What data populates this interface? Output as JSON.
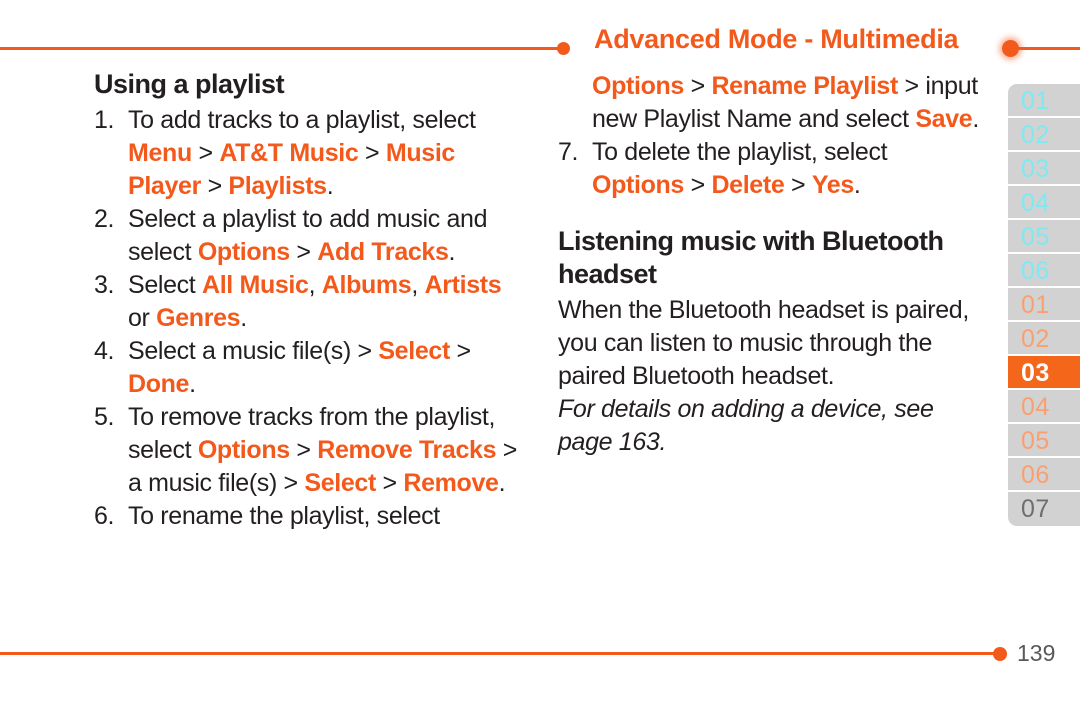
{
  "header": {
    "title": "Advanced Mode - Multimedia",
    "left_dot": "bullet-dot",
    "right_dot": "bullet-dot"
  },
  "colors": {
    "accent_orange": "#f4591c",
    "active_tab_orange": "#f4661a",
    "tab_background_gray": "#d2d2d2",
    "tab_cyan_text": "#7fe9f2",
    "tab_orange_text": "#f9a072",
    "body_text": "#231f20",
    "page_number_gray": "#58595b"
  },
  "left_column": {
    "heading": "Using a playlist",
    "steps": [
      {
        "num": "1.",
        "parts": [
          {
            "t": "To add tracks to a playlist, select ",
            "s": "plain"
          },
          {
            "t": "Menu",
            "s": "hl"
          },
          {
            "t": " > ",
            "s": "sep"
          },
          {
            "t": "AT&T Music",
            "s": "hl"
          },
          {
            "t": " > ",
            "s": "sep"
          },
          {
            "t": "Music Player",
            "s": "hl"
          },
          {
            "t": " > ",
            "s": "sep"
          },
          {
            "t": "Playlists",
            "s": "hl"
          },
          {
            "t": ".",
            "s": "plain"
          }
        ]
      },
      {
        "num": "2.",
        "parts": [
          {
            "t": "Select a playlist to add music and select ",
            "s": "plain"
          },
          {
            "t": "Options",
            "s": "hl"
          },
          {
            "t": " > ",
            "s": "sep"
          },
          {
            "t": "Add Tracks",
            "s": "hl"
          },
          {
            "t": ".",
            "s": "plain"
          }
        ]
      },
      {
        "num": "3.",
        "parts": [
          {
            "t": "Select ",
            "s": "plain"
          },
          {
            "t": "All Music",
            "s": "hl"
          },
          {
            "t": ", ",
            "s": "plain"
          },
          {
            "t": "Albums",
            "s": "hl"
          },
          {
            "t": ", ",
            "s": "plain"
          },
          {
            "t": "Artists",
            "s": "hl"
          },
          {
            "t": " or ",
            "s": "plain"
          },
          {
            "t": "Genres",
            "s": "hl"
          },
          {
            "t": ".",
            "s": "plain"
          }
        ]
      },
      {
        "num": "4.",
        "parts": [
          {
            "t": "Select a music file(s) > ",
            "s": "plain"
          },
          {
            "t": "Select",
            "s": "hl"
          },
          {
            "t": " > ",
            "s": "sep"
          },
          {
            "t": "Done",
            "s": "hl"
          },
          {
            "t": ".",
            "s": "plain"
          }
        ]
      },
      {
        "num": "5.",
        "parts": [
          {
            "t": "To remove tracks from the playlist, select ",
            "s": "plain"
          },
          {
            "t": "Options",
            "s": "hl"
          },
          {
            "t": " > ",
            "s": "sep"
          },
          {
            "t": "Remove Tracks",
            "s": "hl"
          },
          {
            "t": " > a music file(s) > ",
            "s": "plain"
          },
          {
            "t": "Select",
            "s": "hl"
          },
          {
            "t": " > ",
            "s": "sep"
          },
          {
            "t": "Remove",
            "s": "hl"
          },
          {
            "t": ".",
            "s": "plain"
          }
        ]
      },
      {
        "num": "6.",
        "parts": [
          {
            "t": "To rename the playlist, select",
            "s": "plain"
          }
        ]
      }
    ]
  },
  "right_column": {
    "continuation": {
      "parts": [
        {
          "t": "Options",
          "s": "hl"
        },
        {
          "t": " > ",
          "s": "sep"
        },
        {
          "t": "Rename Playlist",
          "s": "hl"
        },
        {
          "t": " > input new Playlist Name and select ",
          "s": "plain"
        },
        {
          "t": "Save",
          "s": "hl"
        },
        {
          "t": ".",
          "s": "plain"
        }
      ]
    },
    "steps": [
      {
        "num": "7.",
        "parts": [
          {
            "t": "To delete the playlist, select ",
            "s": "plain"
          },
          {
            "t": "Options",
            "s": "hl"
          },
          {
            "t": " > ",
            "s": "sep"
          },
          {
            "t": "Delete",
            "s": "hl"
          },
          {
            "t": " > ",
            "s": "sep"
          },
          {
            "t": "Yes",
            "s": "hl"
          },
          {
            "t": ".",
            "s": "plain"
          }
        ]
      }
    ],
    "heading": "Listening music with Bluetooth headset",
    "paragraph": "When the Bluetooth headset is paired, you can listen to music through the paired Bluetooth headset.",
    "note": "For details on adding a device, see page 163."
  },
  "tab_strip": [
    {
      "label": "01",
      "style": "cyan",
      "active": false
    },
    {
      "label": "02",
      "style": "cyan",
      "active": false
    },
    {
      "label": "03",
      "style": "cyan",
      "active": false
    },
    {
      "label": "04",
      "style": "cyan",
      "active": false
    },
    {
      "label": "05",
      "style": "cyan",
      "active": false
    },
    {
      "label": "06",
      "style": "cyan",
      "active": false
    },
    {
      "label": "01",
      "style": "orange",
      "active": false
    },
    {
      "label": "02",
      "style": "orange",
      "active": false
    },
    {
      "label": "03",
      "style": "active",
      "active": true
    },
    {
      "label": "04",
      "style": "orange",
      "active": false
    },
    {
      "label": "05",
      "style": "orange",
      "active": false
    },
    {
      "label": "06",
      "style": "orange",
      "active": false
    },
    {
      "label": "07",
      "style": "dark",
      "active": false
    }
  ],
  "footer": {
    "page_number": "139",
    "dot": "bullet-dot"
  }
}
